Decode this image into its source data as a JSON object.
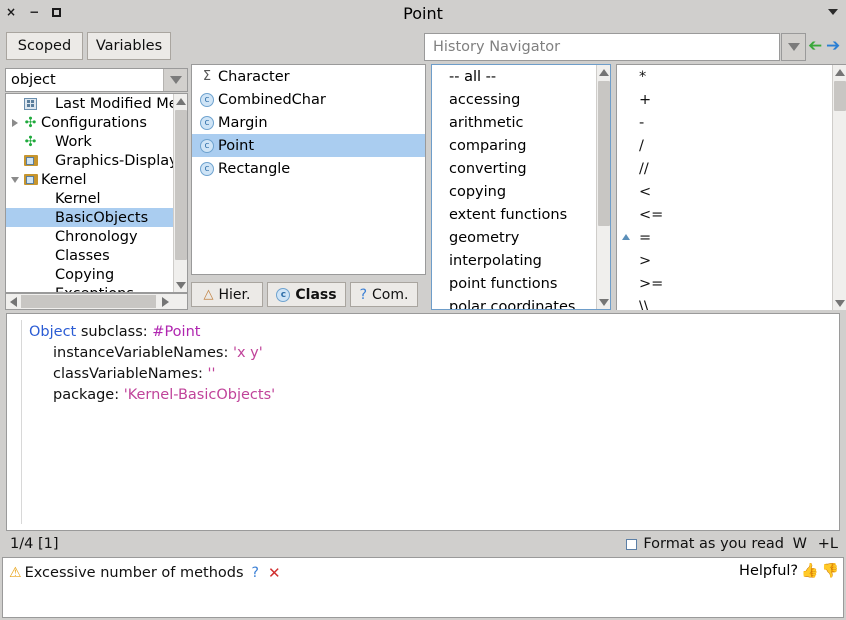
{
  "window": {
    "title": "Point",
    "controls": {
      "close": "×",
      "minimize": "−",
      "maximize": ""
    },
    "menu_icon": "chevron-down-icon"
  },
  "toolbar": {
    "tabs": [
      {
        "label": "Scoped"
      },
      {
        "label": "Variables"
      }
    ],
    "history": {
      "placeholder": "History Navigator",
      "value": "",
      "dropdown_icon": "chevron-down-icon",
      "back_icon": "arrow-left-icon",
      "forward_icon": "arrow-right-icon",
      "back_color": "#3aa83a",
      "forward_color": "#2a7fd4"
    }
  },
  "package_selector": {
    "value": "object",
    "dropdown_icon": "chevron-down-icon"
  },
  "tree": {
    "items": [
      {
        "label": "Last Modified Me",
        "icon": "grid-icon",
        "twisty": "none",
        "indent": 1
      },
      {
        "label": "Configurations",
        "icon": "package-icon",
        "twisty": "collapsed",
        "indent": 0
      },
      {
        "label": "Work",
        "icon": "package-icon",
        "twisty": "none",
        "indent": 1
      },
      {
        "label": "Graphics-Display",
        "icon": "folder-icon",
        "twisty": "none",
        "indent": 1
      },
      {
        "label": "Kernel",
        "icon": "folder-icon",
        "twisty": "expanded",
        "indent": 0
      },
      {
        "label": "Kernel",
        "icon": "none",
        "twisty": "none",
        "indent": 2
      },
      {
        "label": "BasicObjects",
        "icon": "none",
        "twisty": "none",
        "indent": 2,
        "selected": true
      },
      {
        "label": "Chronology",
        "icon": "none",
        "twisty": "none",
        "indent": 2
      },
      {
        "label": "Classes",
        "icon": "none",
        "twisty": "none",
        "indent": 2
      },
      {
        "label": "Copying",
        "icon": "none",
        "twisty": "none",
        "indent": 2
      },
      {
        "label": "Exceptions",
        "icon": "none",
        "twisty": "none",
        "indent": 2
      }
    ]
  },
  "classes": {
    "items": [
      {
        "label": "Character",
        "icon": "sigma-icon"
      },
      {
        "label": "CombinedChar",
        "icon": "class-icon"
      },
      {
        "label": "Margin",
        "icon": "class-icon"
      },
      {
        "label": "Point",
        "icon": "class-icon",
        "selected": true
      },
      {
        "label": "Rectangle",
        "icon": "class-icon"
      }
    ],
    "tabs": [
      {
        "label": "Hier.",
        "icon": "hierarchy-icon",
        "active": false
      },
      {
        "label": "Class",
        "icon": "class-icon",
        "active": true
      },
      {
        "label": "Com.",
        "icon": "question-icon",
        "active": false
      }
    ]
  },
  "protocols": {
    "items": [
      {
        "label": "-- all --"
      },
      {
        "label": "accessing"
      },
      {
        "label": "arithmetic"
      },
      {
        "label": "comparing"
      },
      {
        "label": "converting"
      },
      {
        "label": "copying"
      },
      {
        "label": "extent functions"
      },
      {
        "label": "geometry"
      },
      {
        "label": "interpolating"
      },
      {
        "label": "point functions"
      },
      {
        "label": "polar coordinates"
      }
    ]
  },
  "methods": {
    "items": [
      {
        "label": "*"
      },
      {
        "label": "+"
      },
      {
        "label": "-"
      },
      {
        "label": "/"
      },
      {
        "label": "//"
      },
      {
        "label": "<"
      },
      {
        "label": "<="
      },
      {
        "label": "=",
        "marker": "override-up-icon"
      },
      {
        "label": ">"
      },
      {
        "label": ">="
      },
      {
        "label": "\\\\"
      }
    ]
  },
  "editor": {
    "lines": [
      {
        "parts": [
          {
            "text": "Object",
            "style": "kw"
          },
          {
            "text": " subclass: ",
            "style": "plain"
          },
          {
            "text": "#Point",
            "style": "sym"
          }
        ],
        "indent": false
      },
      {
        "parts": [
          {
            "text": "instanceVariableNames: ",
            "style": "plain"
          },
          {
            "text": "'x y'",
            "style": "str"
          }
        ],
        "indent": true
      },
      {
        "parts": [
          {
            "text": "classVariableNames: ",
            "style": "plain"
          },
          {
            "text": "''",
            "style": "str"
          }
        ],
        "indent": true
      },
      {
        "parts": [
          {
            "text": "package: ",
            "style": "plain"
          },
          {
            "text": "'Kernel-BasicObjects'",
            "style": "str"
          }
        ],
        "indent": true
      }
    ]
  },
  "status": {
    "position": "1/4 [1]",
    "format_label": "Format as you read",
    "format_checked": false,
    "wrap_label": "W",
    "plus_label": "+L"
  },
  "notification": {
    "warning_icon": "warning-icon",
    "message": "Excessive number of methods",
    "help_icon": "question-icon",
    "dismiss_icon": "close-icon",
    "helpful_label": "Helpful?",
    "thumbs_up_icon": "thumbs-up-icon",
    "thumbs_down_icon": "thumbs-down-icon"
  },
  "colors": {
    "selection": "#aacdf0",
    "chrome": "#d0cfcd",
    "keyword": "#2b5cd4",
    "symbol": "#b026b0",
    "string": "#c0439a",
    "warning": "#e8a317",
    "error": "#d03030"
  }
}
